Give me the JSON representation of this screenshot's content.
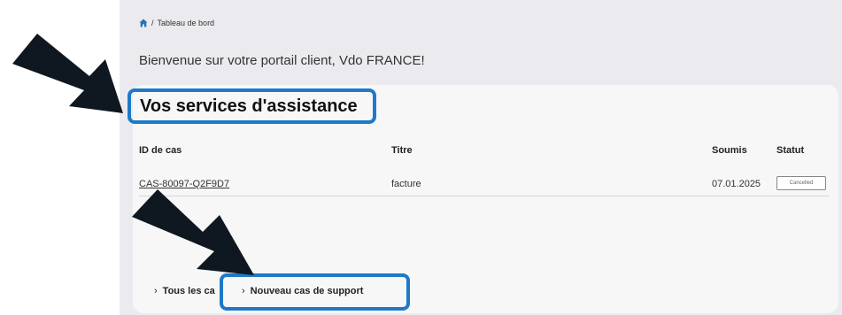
{
  "breadcrumb": {
    "home_icon": "home-icon",
    "separator": "/",
    "current": "Tableau de bord"
  },
  "welcome": "Bienvenue sur votre portail client, Vdo FRANCE!",
  "card": {
    "title": "Vos services d'assistance",
    "columns": {
      "case_id": "ID de cas",
      "title": "Titre",
      "submitted": "Soumis",
      "status": "Statut"
    },
    "rows": [
      {
        "case_id": "CAS-80097-Q2F9D7",
        "title": "facture",
        "submitted": "07.01.2025",
        "status": "Cancelled"
      }
    ],
    "footer": {
      "all_cases": "Tous les ca",
      "new_case": "Nouveau cas de support"
    }
  },
  "colors": {
    "highlight": "#1e7ac8",
    "arrow": "#0f1720",
    "accent_home": "#2e6fb5"
  }
}
